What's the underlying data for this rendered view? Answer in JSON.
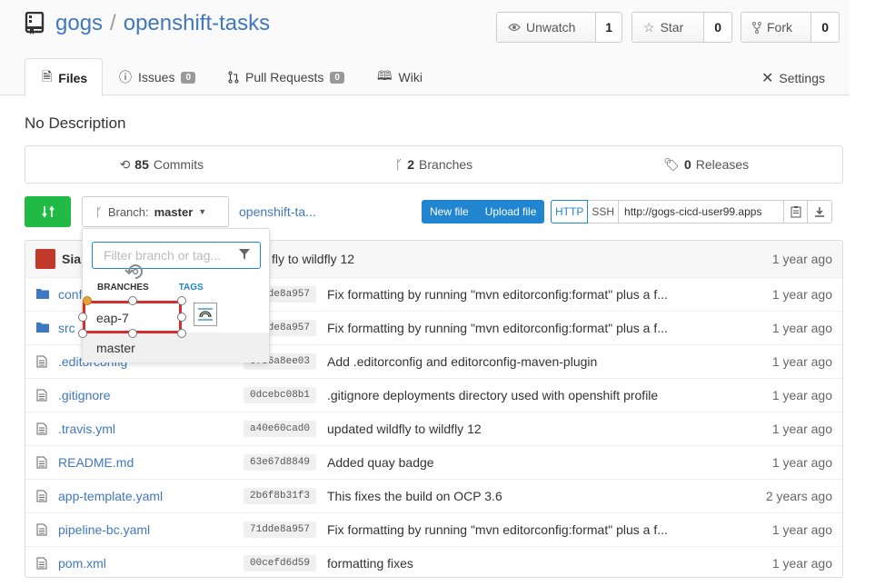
{
  "repo": {
    "owner": "gogs",
    "separator": "/",
    "name": "openshift-tasks"
  },
  "actions": {
    "watch": {
      "label": "Unwatch",
      "count": "1"
    },
    "star": {
      "label": "Star",
      "count": "0"
    },
    "fork": {
      "label": "Fork",
      "count": "0"
    }
  },
  "tabs": [
    {
      "label": "Files"
    },
    {
      "label": "Issues",
      "badge": "0"
    },
    {
      "label": "Pull Requests",
      "badge": "0"
    },
    {
      "label": "Wiki"
    }
  ],
  "settings_label": "Settings",
  "description": "No Description",
  "stats": {
    "commits": {
      "count": "85",
      "label": "Commits"
    },
    "branches": {
      "count": "2",
      "label": "Branches"
    },
    "releases": {
      "count": "0",
      "label": "Releases"
    }
  },
  "branch_button": {
    "prefix": "Branch:",
    "value": "master"
  },
  "path_link": "openshift-ta...",
  "file_buttons": {
    "new_file": "New file",
    "upload_file": "Upload file"
  },
  "clone": {
    "http": "HTTP",
    "ssh": "SSH",
    "url": "http://gogs-cicd-user99.apps"
  },
  "latest_commit": {
    "author": "Siar",
    "message": "fly to wildfly 12",
    "age": "1 year ago"
  },
  "files": [
    {
      "name": "conf",
      "type": "folder",
      "sha": "71dde8a957",
      "message": "Fix formatting by running \"mvn editorconfig:format\" plus a f...",
      "age": "1 year ago"
    },
    {
      "name": "src",
      "type": "folder",
      "sha": "71dde8a957",
      "message": "Fix formatting by running \"mvn editorconfig:format\" plus a f...",
      "age": "1 year ago"
    },
    {
      "name": ".editorconfig",
      "type": "file",
      "sha": "0f56a8ee03",
      "message": "Add .editorconfig and editorconfig-maven-plugin",
      "age": "1 year ago"
    },
    {
      "name": ".gitignore",
      "type": "file",
      "sha": "0dcebc08b1",
      "message": ".gitignore deployments directory used with openshift profile",
      "age": "1 year ago"
    },
    {
      "name": ".travis.yml",
      "type": "file",
      "sha": "a40e60cad0",
      "message": "updated wildfly to wildfly 12",
      "age": "1 year ago"
    },
    {
      "name": "README.md",
      "type": "file",
      "sha": "63e67d8849",
      "message": "Added quay badge",
      "age": "1 year ago"
    },
    {
      "name": "app-template.yaml",
      "type": "file",
      "sha": "2b6f8b31f3",
      "message": "This fixes the build on OCP 3.6",
      "age": "2 years ago"
    },
    {
      "name": "pipeline-bc.yaml",
      "type": "file",
      "sha": "71dde8a957",
      "message": "Fix formatting by running \"mvn editorconfig:format\" plus a f...",
      "age": "1 year ago"
    },
    {
      "name": "pom.xml",
      "type": "file",
      "sha": "00cefd6d59",
      "message": "formatting fixes",
      "age": "1 year ago"
    }
  ],
  "branch_dropdown": {
    "filter_placeholder": "Filter branch or tag...",
    "tab_branches": "BRANCHES",
    "tab_tags": "TAGS",
    "items": [
      "eap-7",
      "master"
    ]
  },
  "colors": {
    "link": "#4078c0",
    "green": "#21ba45",
    "blue": "#2185d0",
    "selection": "#d32f2f"
  }
}
